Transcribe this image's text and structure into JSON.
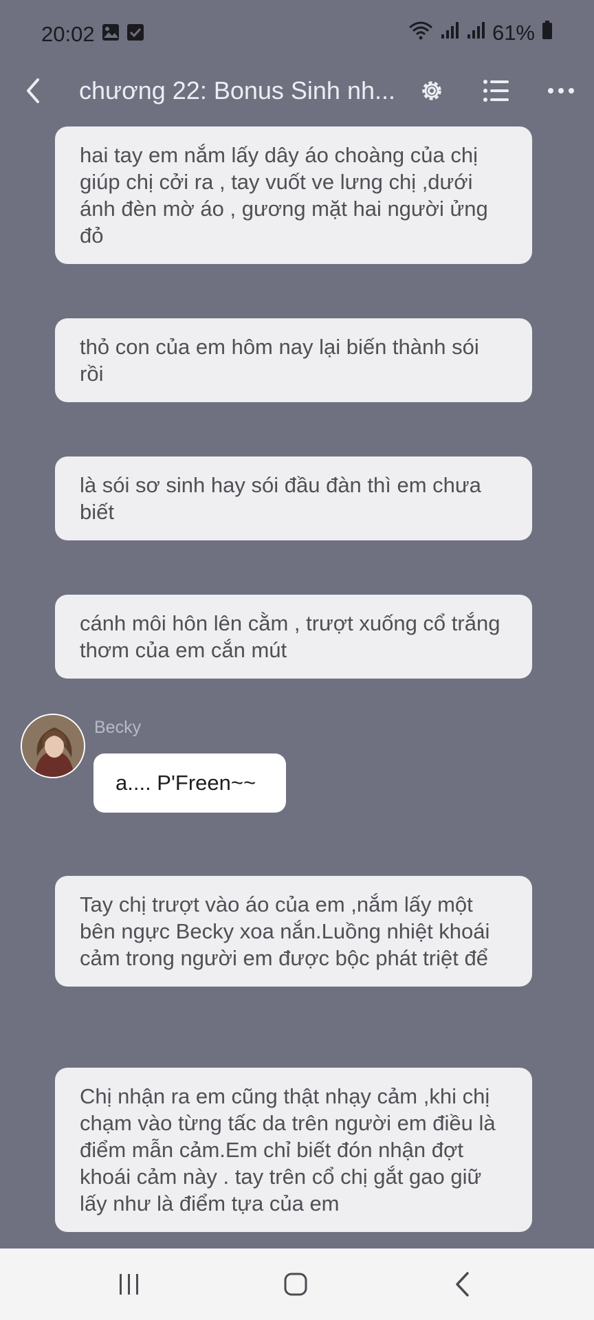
{
  "status_bar": {
    "time": "20:02",
    "left_icons": [
      "gallery-icon",
      "checkbox-icon"
    ],
    "right_icons": [
      "wifi-icon",
      "signal-icon",
      "signal-icon",
      "battery-icon"
    ],
    "battery": "61%"
  },
  "header": {
    "title": "chương 22: Bonus Sinh nh...",
    "buttons": [
      "back-icon",
      "gear-icon",
      "list-icon",
      "more-icon"
    ]
  },
  "messages": [
    {
      "type": "narration",
      "text": "hai tay em nắm lấy dây áo choàng của chị giúp chị cởi ra , tay vuốt ve lưng chị ,dưới ánh đèn mờ áo , gương mặt hai người ửng đỏ"
    },
    {
      "type": "narration",
      "text": "thỏ con của em hôm nay lại biến thành sói rồi"
    },
    {
      "type": "narration",
      "text": "là sói sơ sinh hay sói đầu đàn thì em chưa biết"
    },
    {
      "type": "narration",
      "text": "cánh môi hôn lên cằm , trượt xuống cổ trắng thơm của em cắn mút"
    },
    {
      "type": "character",
      "name": "Becky",
      "text": "a.... P'Freen~~"
    },
    {
      "type": "narration",
      "text": "Tay chị trượt vào áo của em ,nắm lấy một bên ngực Becky xoa nắn.Luồng nhiệt khoái cảm trong người em được bộc phát triệt để"
    },
    {
      "type": "narration",
      "text": "Chị nhận ra em cũng thật nhạy cảm ,khi chị chạm vào từng tấc da trên người em điều là điểm mẫn cảm.Em chỉ biết đón nhận đợt khoái cảm này . tay trên cổ chị gắt gao giữ lấy như là điểm tựa của em"
    }
  ],
  "nav_bar": {
    "buttons": [
      "recent-apps-icon",
      "home-icon",
      "back-icon"
    ]
  }
}
